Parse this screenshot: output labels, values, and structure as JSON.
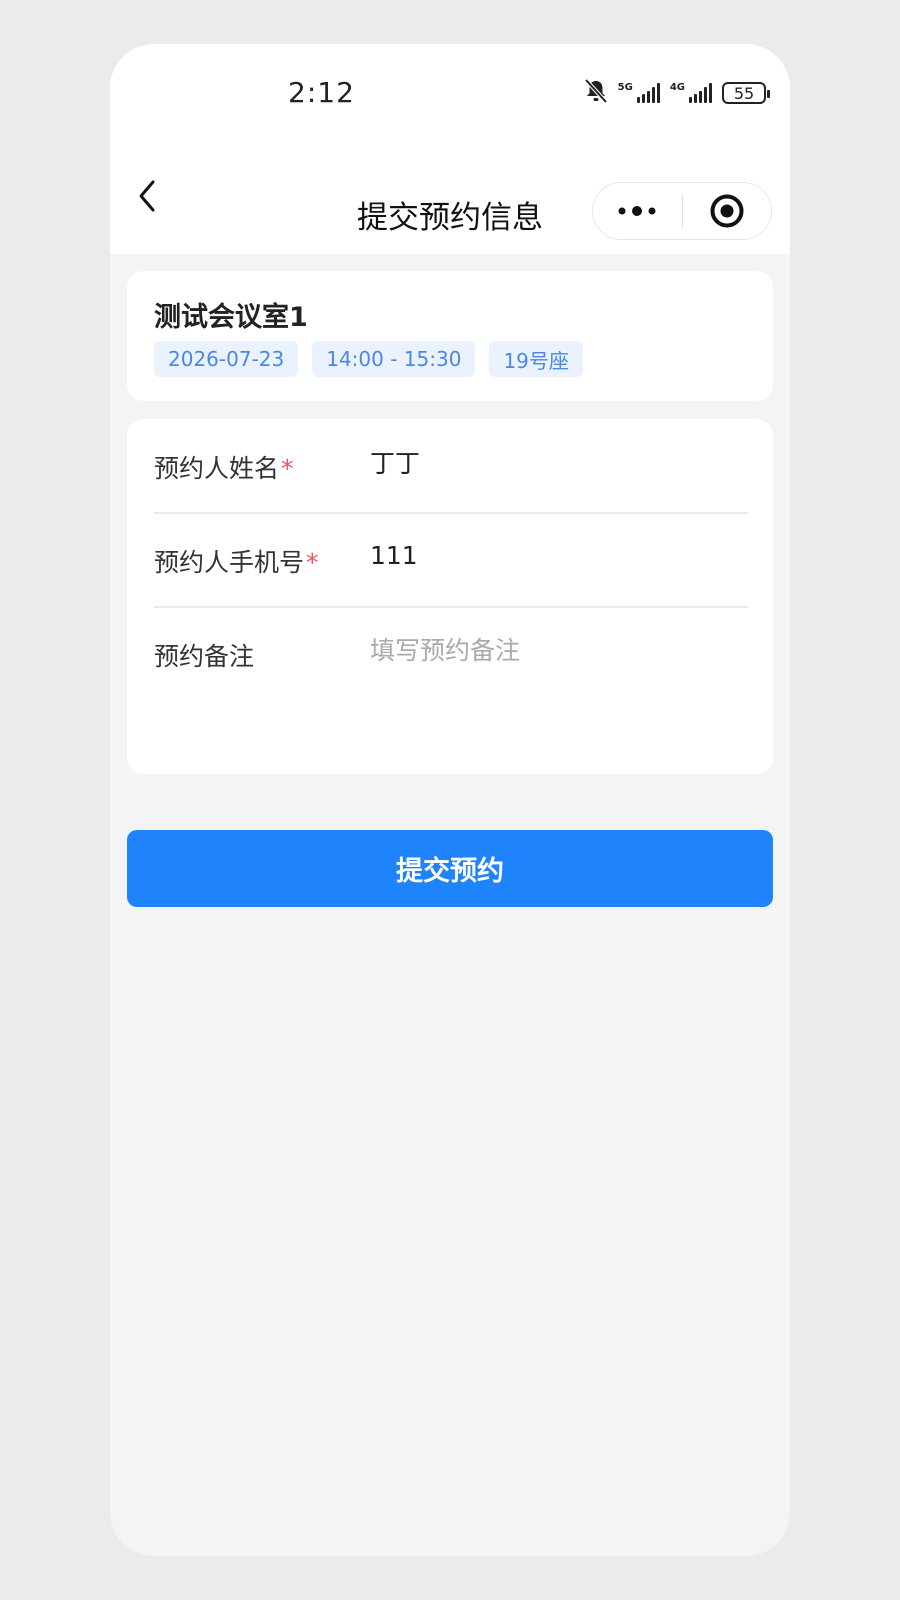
{
  "status_bar": {
    "time": "2:12",
    "net1": "5G",
    "net2": "4G",
    "battery": "55",
    "icons": [
      "bell-muted-icon",
      "signal-5g-icon",
      "signal-4g-icon",
      "battery-icon"
    ]
  },
  "navbar": {
    "title": "提交预约信息",
    "icons": [
      "back-chevron-icon",
      "more-dots-icon",
      "target-circle-icon"
    ]
  },
  "room": {
    "name": "测试会议室1",
    "tags": [
      "2026-07-23",
      "14:00 - 15:30",
      "19号座"
    ]
  },
  "form": {
    "name_label": "预约人姓名",
    "name_value": "丁丁",
    "phone_label": "预约人手机号",
    "phone_value": "111",
    "remark_label": "预约备注",
    "remark_placeholder": "填写预约备注",
    "required_mark": "*"
  },
  "submit_label": "提交预约",
  "colors": {
    "accent": "#1f84fc",
    "tag_bg": "#eaf2fe",
    "tag_text": "#4b88e6",
    "required": "#e9565b"
  }
}
